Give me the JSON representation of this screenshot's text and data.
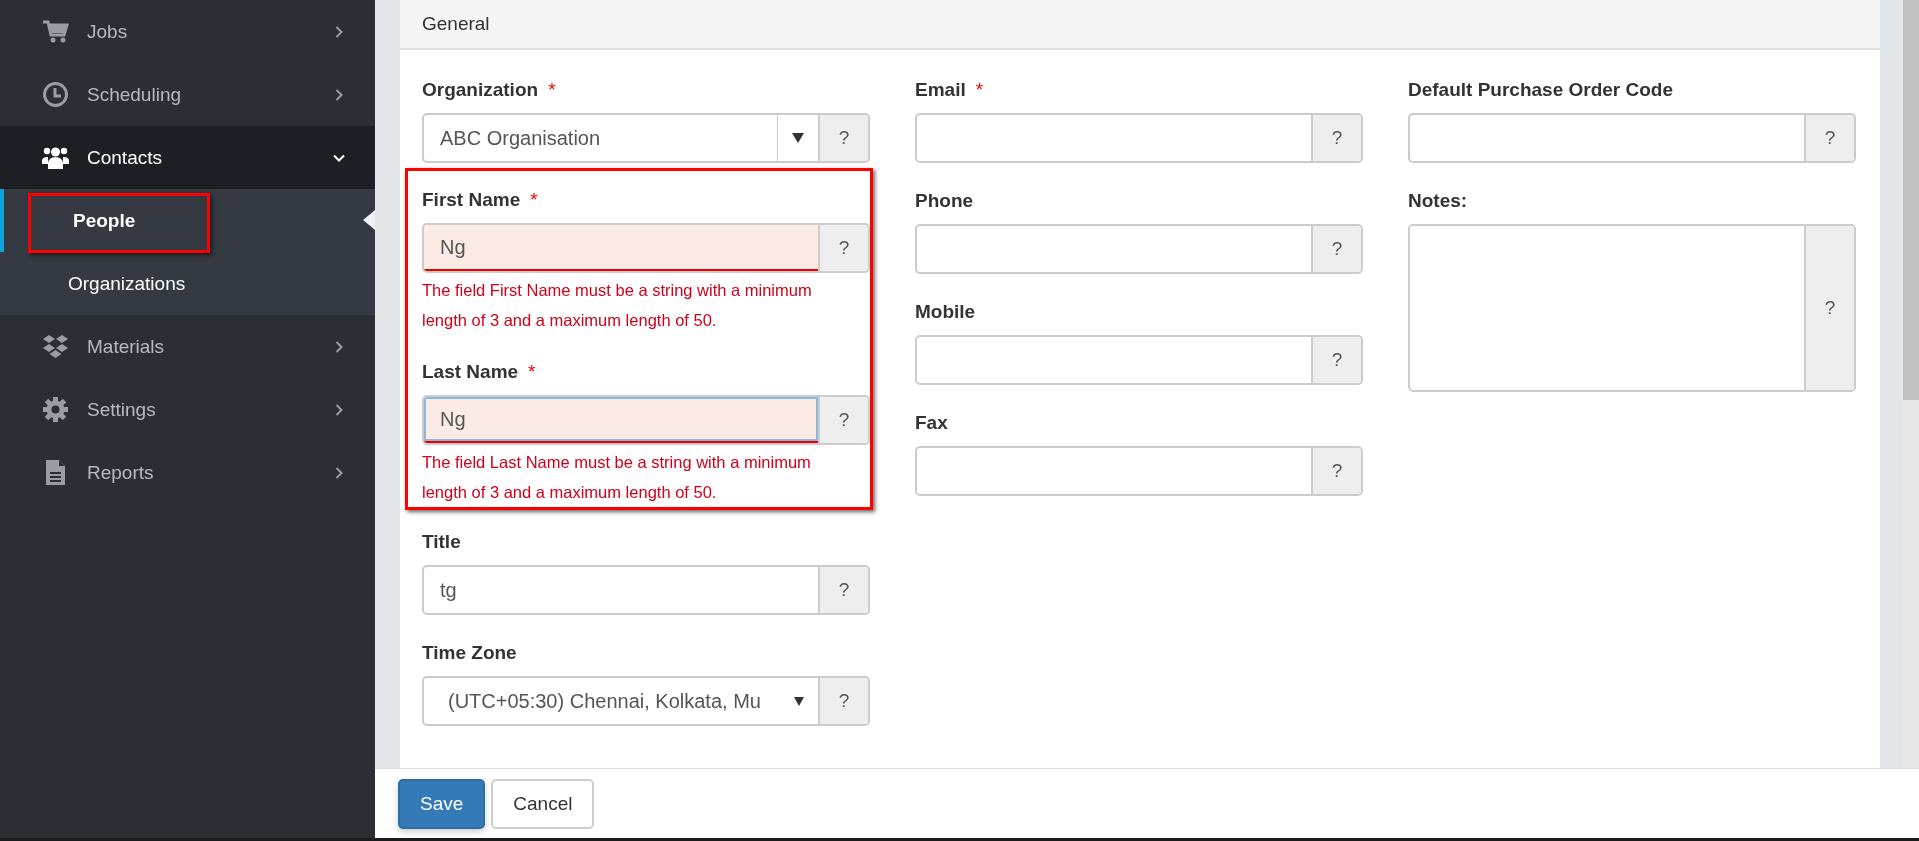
{
  "sidebar": {
    "items": [
      {
        "label": "Jobs",
        "expanded": false
      },
      {
        "label": "Scheduling",
        "expanded": false
      },
      {
        "label": "Contacts",
        "expanded": true,
        "children": [
          {
            "label": "People",
            "selected": true,
            "annotated": true
          },
          {
            "label": "Organizations",
            "selected": false,
            "annotated": false
          }
        ]
      },
      {
        "label": "Materials",
        "expanded": false
      },
      {
        "label": "Settings",
        "expanded": false
      },
      {
        "label": "Reports",
        "expanded": false
      }
    ]
  },
  "panel": {
    "title": "General",
    "columns": [
      [
        {
          "kind": "combobox",
          "label": "Organization",
          "required_mark": "*",
          "value": "ABC Organisation",
          "help": "?"
        },
        {
          "kind": "text",
          "label": "First Name",
          "required_mark": "*",
          "value": "Ng",
          "invalid": true,
          "focused": false,
          "annotated": true,
          "error": "The field First Name must be a string with a minimum length of 3 and a maximum length of 50.",
          "help": "?"
        },
        {
          "kind": "text",
          "label": "Last Name",
          "required_mark": "*",
          "value": "Ng",
          "invalid": true,
          "focused": true,
          "annotated": true,
          "error": "The field Last Name must be a string with a minimum length of 3 and a maximum length of 50.",
          "help": "?"
        },
        {
          "kind": "text",
          "label": "Title",
          "value": "tg",
          "invalid": false,
          "focused": false,
          "help": "?"
        },
        {
          "kind": "select",
          "label": "Time Zone",
          "value": "(UTC+05:30) Chennai, Kolkata, Mu",
          "help": "?"
        }
      ],
      [
        {
          "kind": "text",
          "label": "Email",
          "required_mark": "*",
          "invalid": false,
          "focused": false,
          "help": "?"
        },
        {
          "kind": "text",
          "label": "Phone",
          "invalid": false,
          "focused": false,
          "help": "?"
        },
        {
          "kind": "text",
          "label": "Mobile",
          "invalid": false,
          "focused": false,
          "help": "?"
        },
        {
          "kind": "text",
          "label": "Fax",
          "invalid": false,
          "focused": false,
          "help": "?"
        }
      ],
      [
        {
          "kind": "text",
          "label": "Default Purchase Order Code",
          "invalid": false,
          "focused": false,
          "help": "?"
        },
        {
          "kind": "textarea",
          "label": "Notes:",
          "help": "?"
        }
      ]
    ]
  },
  "buttons": [
    {
      "label": "Save",
      "primary": true
    },
    {
      "label": "Cancel",
      "primary": false
    }
  ]
}
